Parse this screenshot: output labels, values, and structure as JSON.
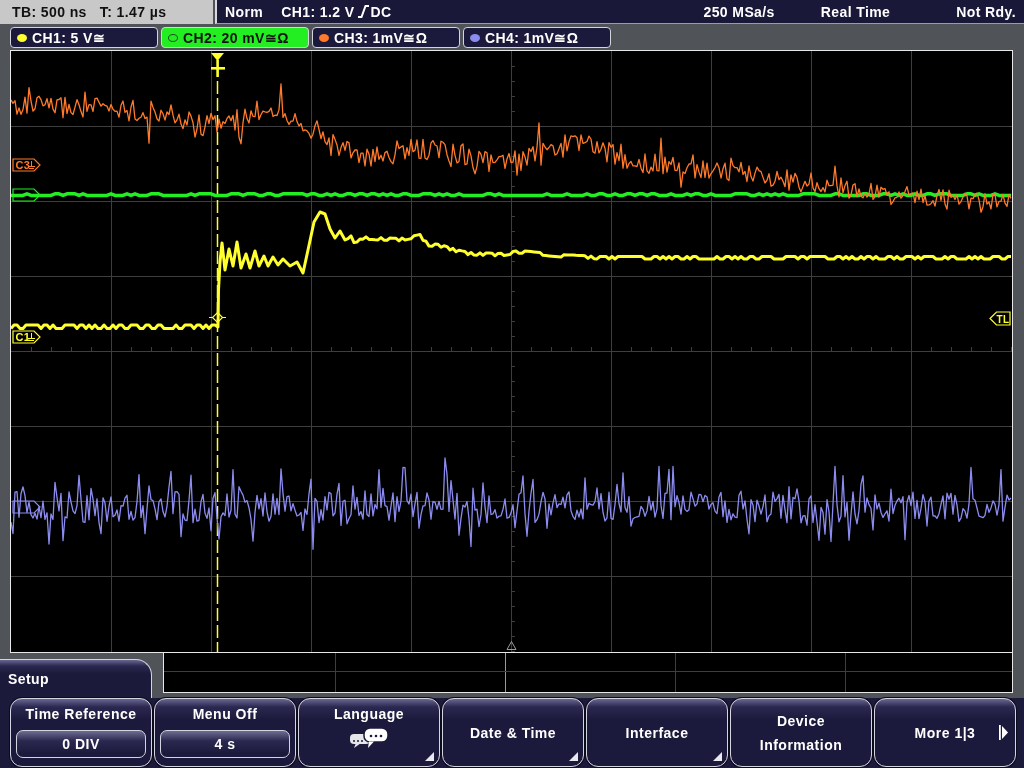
{
  "status_bar": {
    "timebase": "TB: 500 ns",
    "trigger_time": "T: 1.47 µs",
    "trigger_mode": "Norm",
    "trigger_level": "CH1: 1.2 V",
    "trigger_coupling": "DC",
    "sample_rate": "250 MSa/s",
    "acquisition_mode": "Real Time",
    "state": "Not Rdy."
  },
  "channels": [
    {
      "label": "CH1: 5 V≅",
      "color": "#ffff30",
      "selected": false
    },
    {
      "label": "CH2: 20 mV≅Ω",
      "color": "#22ee22",
      "selected": true
    },
    {
      "label": "CH3: 1mV≅Ω",
      "color": "#ff7a2a",
      "selected": false
    },
    {
      "label": "CH4: 1mV≅Ω",
      "color": "#8c8cf0",
      "selected": false
    }
  ],
  "display": {
    "channel_markers": [
      {
        "label": "C3",
        "color": "#ff7a2a"
      },
      {
        "color": "#22ee22"
      },
      {
        "label": "C1",
        "color": "#ffff30"
      },
      {
        "color": "#8c8cf0"
      }
    ],
    "trigger_level_marker": "TL"
  },
  "menu": {
    "title": "Setup",
    "soft_keys": [
      {
        "label": "Time Reference",
        "kind": "value",
        "value": "0 DIV"
      },
      {
        "label": "Menu Off",
        "kind": "value",
        "value": "4 s"
      },
      {
        "label": "Language",
        "kind": "icon_submenu"
      },
      {
        "label": "Date & Time",
        "kind": "submenu"
      },
      {
        "label": "Interface",
        "kind": "submenu"
      },
      {
        "label": "Device Information",
        "kind": "plain"
      },
      {
        "label": "More 1|3",
        "kind": "next"
      }
    ]
  }
}
